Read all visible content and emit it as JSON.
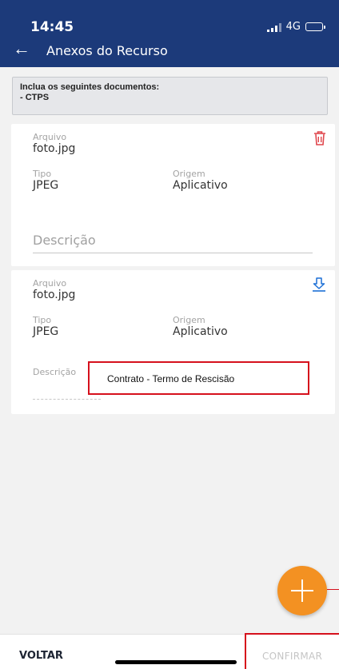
{
  "status_bar": {
    "time": "14:45",
    "network": "4G"
  },
  "header": {
    "title": "Anexos do Recurso"
  },
  "notice": {
    "line1": "Inclua os seguintes documentos:",
    "line2": "- CTPS"
  },
  "attachments": [
    {
      "file_label": "Arquivo",
      "file_value": "foto.jpg",
      "type_label": "Tipo",
      "type_value": "JPEG",
      "origin_label": "Origem",
      "origin_value": "Aplicativo",
      "description_placeholder": "Descrição",
      "action_icon": "trash-icon"
    },
    {
      "file_label": "Arquivo",
      "file_value": "foto.jpg",
      "type_label": "Tipo",
      "type_value": "JPEG",
      "origin_label": "Origem",
      "origin_value": "Aplicativo",
      "description_label": "Descrição",
      "description_value": "Contrato - Termo de Rescisão",
      "action_icon": "download-icon"
    }
  ],
  "bottom_bar": {
    "back_label": "VOLTAR",
    "confirm_label": "CONFIRMAR"
  },
  "colors": {
    "header": "#1c3a7a",
    "fab": "#f39122",
    "delete": "#e0464c",
    "download": "#1c6fd6",
    "highlight": "#d6101c"
  }
}
